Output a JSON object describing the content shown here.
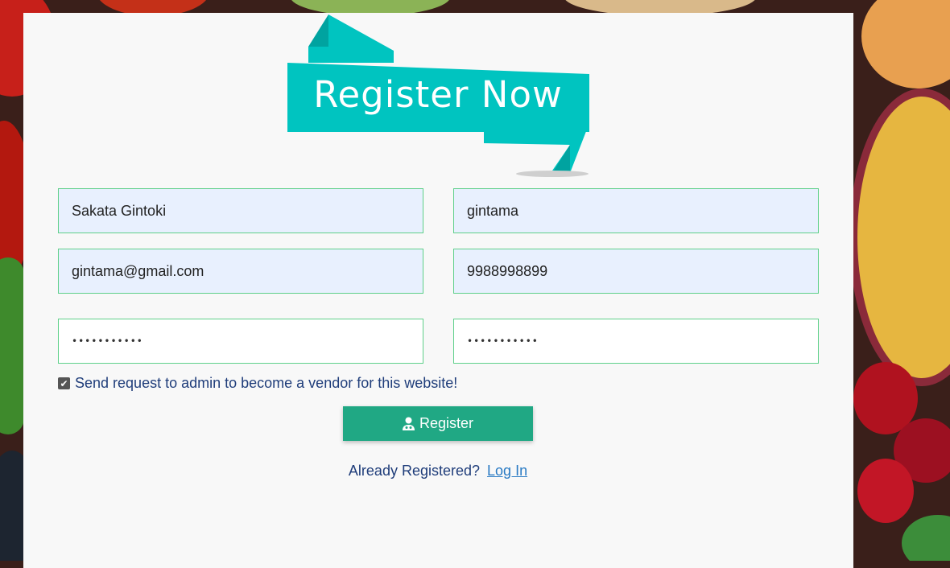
{
  "banner": {
    "title": "Register Now"
  },
  "form": {
    "full_name": {
      "value": "Sakata Gintoki"
    },
    "username": {
      "value": "gintama"
    },
    "email": {
      "value": "gintama@gmail.com"
    },
    "phone": {
      "value": "9988998899"
    },
    "password": {
      "masked": "•••••••••••"
    },
    "confirm_password": {
      "masked": "•••••••••••"
    },
    "vendor_request": {
      "label": "Send request to admin to become a vendor for this website!",
      "checked": true
    },
    "register_button": {
      "label": "Register",
      "icon": "user-doctor-icon"
    }
  },
  "footer": {
    "prompt": "Already Registered?",
    "login_link": "Log In"
  },
  "colors": {
    "accent": "#20a884",
    "banner": "#00c4c0",
    "field_border": "#5fd08a",
    "text": "#1f3d7a",
    "link": "#2a7bc4"
  }
}
